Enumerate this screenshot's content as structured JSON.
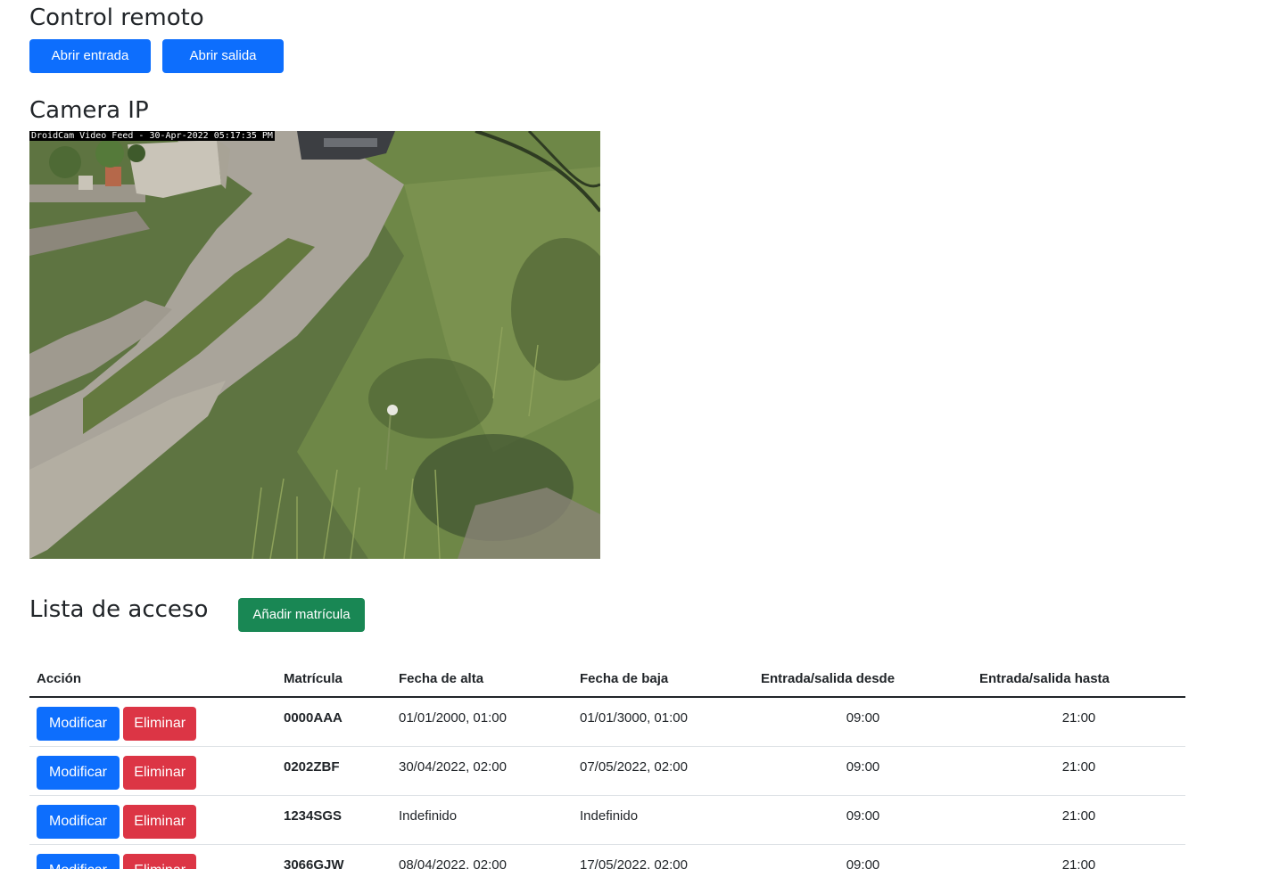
{
  "remote_control": {
    "title": "Control remoto",
    "open_entry_label": "Abrir entrada",
    "open_exit_label": "Abrir salida"
  },
  "camera": {
    "title": "Camera IP",
    "overlay_text": "DroidCam Video Feed - 30-Apr-2022 05:17:35 PM"
  },
  "access_list": {
    "title": "Lista de acceso",
    "add_plate_label": "Añadir matrícula",
    "columns": {
      "action": "Acción",
      "plate": "Matrícula",
      "start_date": "Fecha de alta",
      "end_date": "Fecha de baja",
      "from": "Entrada/salida desde",
      "until": "Entrada/salida hasta"
    },
    "modify_label": "Modificar",
    "delete_label": "Eliminar",
    "rows": [
      {
        "plate": "0000AAA",
        "start_date": "01/01/2000, 01:00",
        "end_date": "01/01/3000, 01:00",
        "from": "09:00",
        "until": "21:00"
      },
      {
        "plate": "0202ZBF",
        "start_date": "30/04/2022, 02:00",
        "end_date": "07/05/2022, 02:00",
        "from": "09:00",
        "until": "21:00"
      },
      {
        "plate": "1234SGS",
        "start_date": "Indefinido",
        "end_date": "Indefinido",
        "from": "09:00",
        "until": "21:00"
      },
      {
        "plate": "3066GJW",
        "start_date": "08/04/2022, 02:00",
        "end_date": "17/05/2022, 02:00",
        "from": "09:00",
        "until": "21:00"
      }
    ]
  },
  "colors": {
    "primary": "#0d6efd",
    "success": "#198754",
    "danger": "#dc3545",
    "text": "#212529"
  }
}
